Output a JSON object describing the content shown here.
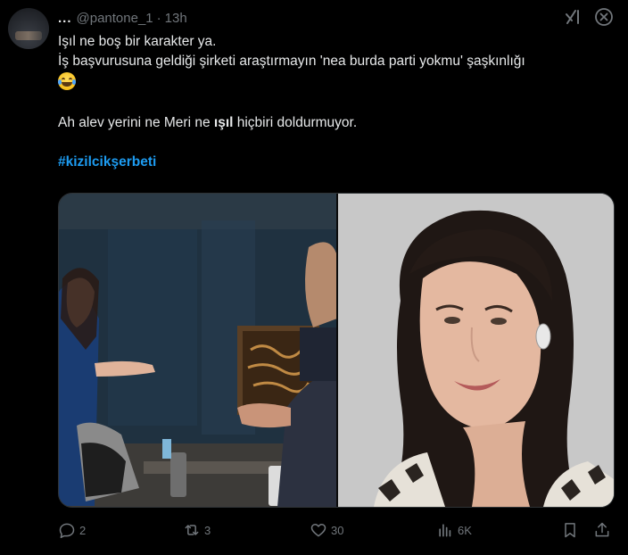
{
  "author": {
    "display_name": "...",
    "handle": "@pantone_1",
    "separator": "·",
    "time": "13h"
  },
  "tweet": {
    "line1": "Işıl ne boş bir karakter ya.",
    "line2": "İş başvurusuna geldiği şirketi araştırmayın 'nea burda parti yokmu' şaşkınlığı",
    "line4_before": "Ah alev yerini ne Meri ne ",
    "line4_bold": "ışıl",
    "line4_after": " hiçbiri doldurmuyor.",
    "hashtag": "#kizilcikşerbeti",
    "emoji": "face-with-tears-of-joy"
  },
  "actions": {
    "replies": "2",
    "reposts": "3",
    "likes": "30",
    "views": "6K"
  },
  "icons": {
    "grok": "grok-icon",
    "more": "more-icon",
    "reply": "reply-icon",
    "repost": "repost-icon",
    "like": "heart-icon",
    "views": "views-icon",
    "bookmark": "bookmark-icon",
    "share": "share-icon"
  },
  "colors": {
    "background": "#000000",
    "text": "#e7e9ea",
    "secondary": "#71767b",
    "link": "#1d9bf0",
    "border": "#2f3336"
  }
}
